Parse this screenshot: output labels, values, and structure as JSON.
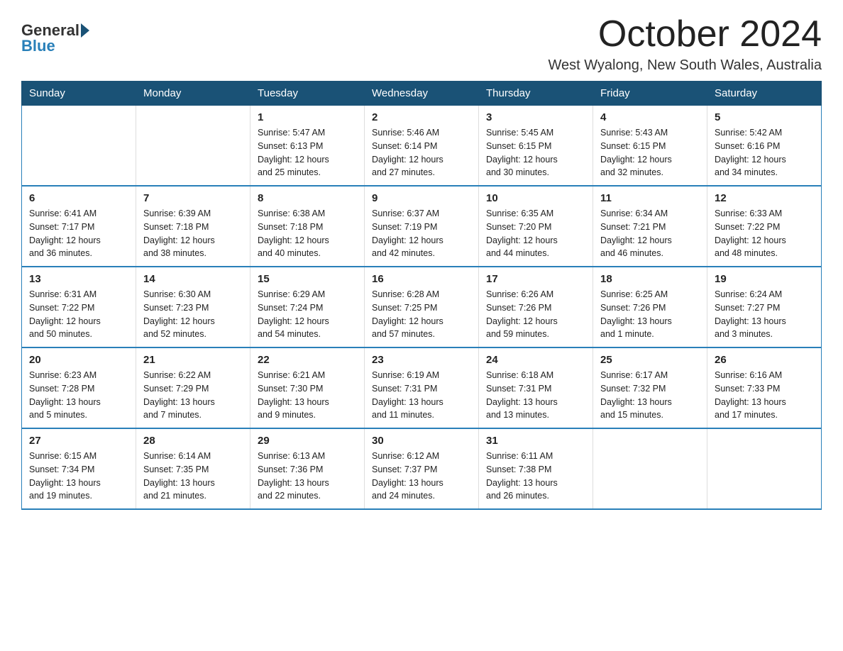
{
  "header": {
    "logo_general": "General",
    "logo_blue": "Blue",
    "month_title": "October 2024",
    "location": "West Wyalong, New South Wales, Australia"
  },
  "days_of_week": [
    "Sunday",
    "Monday",
    "Tuesday",
    "Wednesday",
    "Thursday",
    "Friday",
    "Saturday"
  ],
  "weeks": [
    [
      {
        "day": "",
        "info": ""
      },
      {
        "day": "",
        "info": ""
      },
      {
        "day": "1",
        "info": "Sunrise: 5:47 AM\nSunset: 6:13 PM\nDaylight: 12 hours\nand 25 minutes."
      },
      {
        "day": "2",
        "info": "Sunrise: 5:46 AM\nSunset: 6:14 PM\nDaylight: 12 hours\nand 27 minutes."
      },
      {
        "day": "3",
        "info": "Sunrise: 5:45 AM\nSunset: 6:15 PM\nDaylight: 12 hours\nand 30 minutes."
      },
      {
        "day": "4",
        "info": "Sunrise: 5:43 AM\nSunset: 6:15 PM\nDaylight: 12 hours\nand 32 minutes."
      },
      {
        "day": "5",
        "info": "Sunrise: 5:42 AM\nSunset: 6:16 PM\nDaylight: 12 hours\nand 34 minutes."
      }
    ],
    [
      {
        "day": "6",
        "info": "Sunrise: 6:41 AM\nSunset: 7:17 PM\nDaylight: 12 hours\nand 36 minutes."
      },
      {
        "day": "7",
        "info": "Sunrise: 6:39 AM\nSunset: 7:18 PM\nDaylight: 12 hours\nand 38 minutes."
      },
      {
        "day": "8",
        "info": "Sunrise: 6:38 AM\nSunset: 7:18 PM\nDaylight: 12 hours\nand 40 minutes."
      },
      {
        "day": "9",
        "info": "Sunrise: 6:37 AM\nSunset: 7:19 PM\nDaylight: 12 hours\nand 42 minutes."
      },
      {
        "day": "10",
        "info": "Sunrise: 6:35 AM\nSunset: 7:20 PM\nDaylight: 12 hours\nand 44 minutes."
      },
      {
        "day": "11",
        "info": "Sunrise: 6:34 AM\nSunset: 7:21 PM\nDaylight: 12 hours\nand 46 minutes."
      },
      {
        "day": "12",
        "info": "Sunrise: 6:33 AM\nSunset: 7:22 PM\nDaylight: 12 hours\nand 48 minutes."
      }
    ],
    [
      {
        "day": "13",
        "info": "Sunrise: 6:31 AM\nSunset: 7:22 PM\nDaylight: 12 hours\nand 50 minutes."
      },
      {
        "day": "14",
        "info": "Sunrise: 6:30 AM\nSunset: 7:23 PM\nDaylight: 12 hours\nand 52 minutes."
      },
      {
        "day": "15",
        "info": "Sunrise: 6:29 AM\nSunset: 7:24 PM\nDaylight: 12 hours\nand 54 minutes."
      },
      {
        "day": "16",
        "info": "Sunrise: 6:28 AM\nSunset: 7:25 PM\nDaylight: 12 hours\nand 57 minutes."
      },
      {
        "day": "17",
        "info": "Sunrise: 6:26 AM\nSunset: 7:26 PM\nDaylight: 12 hours\nand 59 minutes."
      },
      {
        "day": "18",
        "info": "Sunrise: 6:25 AM\nSunset: 7:26 PM\nDaylight: 13 hours\nand 1 minute."
      },
      {
        "day": "19",
        "info": "Sunrise: 6:24 AM\nSunset: 7:27 PM\nDaylight: 13 hours\nand 3 minutes."
      }
    ],
    [
      {
        "day": "20",
        "info": "Sunrise: 6:23 AM\nSunset: 7:28 PM\nDaylight: 13 hours\nand 5 minutes."
      },
      {
        "day": "21",
        "info": "Sunrise: 6:22 AM\nSunset: 7:29 PM\nDaylight: 13 hours\nand 7 minutes."
      },
      {
        "day": "22",
        "info": "Sunrise: 6:21 AM\nSunset: 7:30 PM\nDaylight: 13 hours\nand 9 minutes."
      },
      {
        "day": "23",
        "info": "Sunrise: 6:19 AM\nSunset: 7:31 PM\nDaylight: 13 hours\nand 11 minutes."
      },
      {
        "day": "24",
        "info": "Sunrise: 6:18 AM\nSunset: 7:31 PM\nDaylight: 13 hours\nand 13 minutes."
      },
      {
        "day": "25",
        "info": "Sunrise: 6:17 AM\nSunset: 7:32 PM\nDaylight: 13 hours\nand 15 minutes."
      },
      {
        "day": "26",
        "info": "Sunrise: 6:16 AM\nSunset: 7:33 PM\nDaylight: 13 hours\nand 17 minutes."
      }
    ],
    [
      {
        "day": "27",
        "info": "Sunrise: 6:15 AM\nSunset: 7:34 PM\nDaylight: 13 hours\nand 19 minutes."
      },
      {
        "day": "28",
        "info": "Sunrise: 6:14 AM\nSunset: 7:35 PM\nDaylight: 13 hours\nand 21 minutes."
      },
      {
        "day": "29",
        "info": "Sunrise: 6:13 AM\nSunset: 7:36 PM\nDaylight: 13 hours\nand 22 minutes."
      },
      {
        "day": "30",
        "info": "Sunrise: 6:12 AM\nSunset: 7:37 PM\nDaylight: 13 hours\nand 24 minutes."
      },
      {
        "day": "31",
        "info": "Sunrise: 6:11 AM\nSunset: 7:38 PM\nDaylight: 13 hours\nand 26 minutes."
      },
      {
        "day": "",
        "info": ""
      },
      {
        "day": "",
        "info": ""
      }
    ]
  ]
}
